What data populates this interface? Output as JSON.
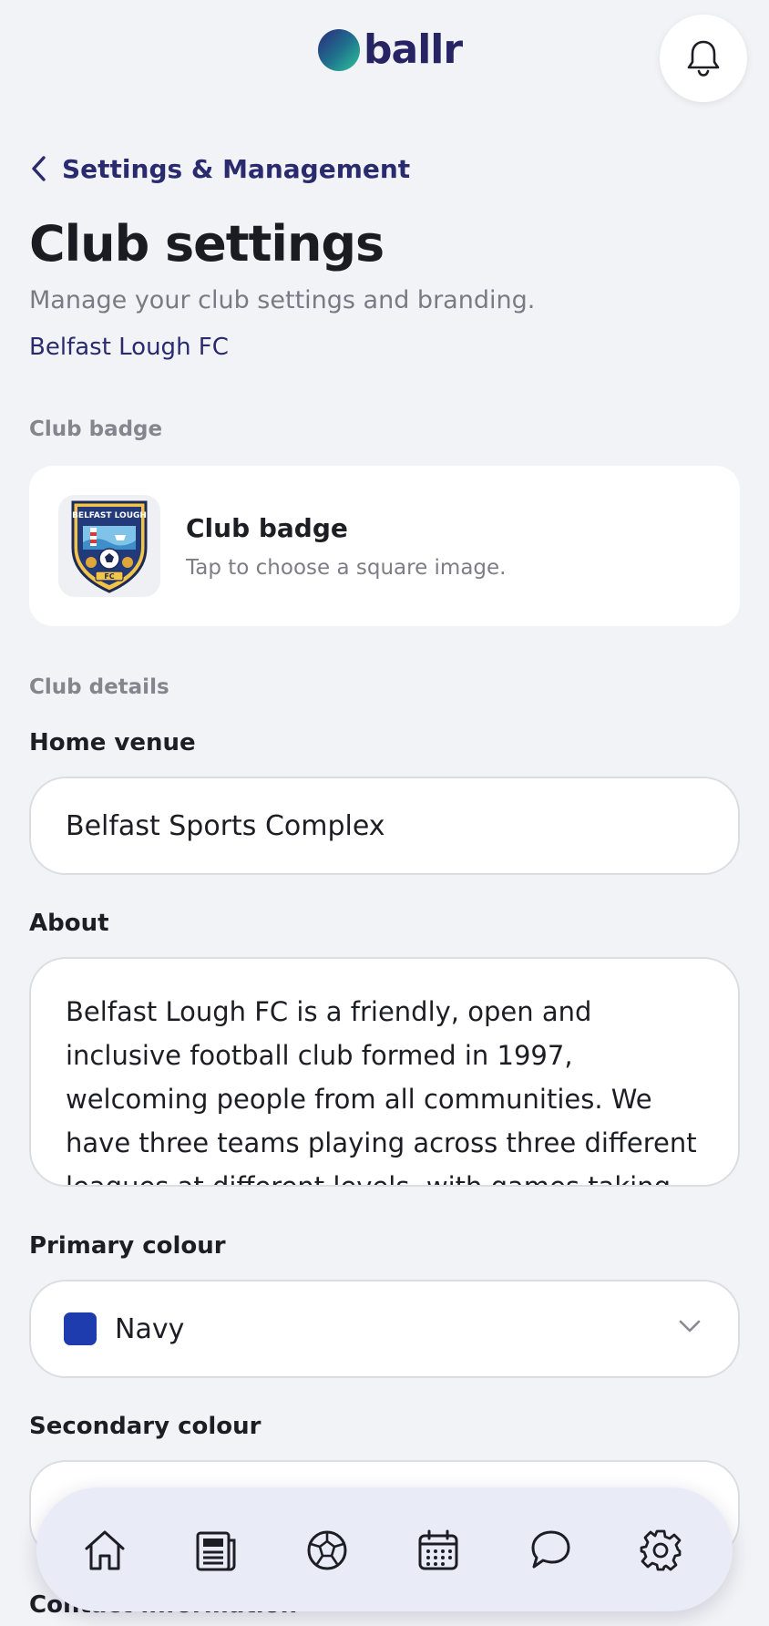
{
  "app": {
    "logo_text": "ballr"
  },
  "nav": {
    "back_label": "Settings & Management"
  },
  "page": {
    "title": "Club settings",
    "subtitle": "Manage your club settings and branding.",
    "club_name": "Belfast Lough FC"
  },
  "badge_section": {
    "label": "Club badge",
    "card_title": "Club badge",
    "card_hint": "Tap to choose a square image.",
    "badge_text": "BELFAST LOUGH",
    "badge_initials": "FC"
  },
  "details_section": {
    "label": "Club details",
    "home_venue": {
      "label": "Home venue",
      "value": "Belfast Sports Complex"
    },
    "about": {
      "label": "About",
      "value": "Belfast Lough FC is a friendly, open and inclusive football club formed in 1997, welcoming people from all communities. We have three teams playing across three different leagues at different levels, with games taking place in Belfast and the"
    },
    "primary_colour": {
      "label": "Primary colour",
      "value": "Navy",
      "swatch": "#1e3cae"
    },
    "secondary_colour": {
      "label": "Secondary colour"
    },
    "next_section_label": "Contact information"
  },
  "bottom_nav": {
    "items": [
      {
        "icon": "home-icon"
      },
      {
        "icon": "news-icon"
      },
      {
        "icon": "football-icon"
      },
      {
        "icon": "calendar-icon"
      },
      {
        "icon": "chat-icon"
      },
      {
        "icon": "settings-icon"
      }
    ]
  },
  "colors": {
    "brand_navy": "#2a2a6e",
    "background": "#f2f3f6",
    "nav_bar": "#e9ebf6"
  }
}
